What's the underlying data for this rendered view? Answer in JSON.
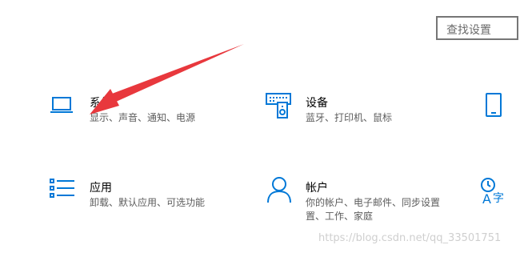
{
  "search": {
    "placeholder": "查找设置"
  },
  "tiles": [
    {
      "icon": "laptop-icon",
      "title": "系统",
      "description": "显示、声音、通知、电源"
    },
    {
      "icon": "devices-icon",
      "title": "设备",
      "description": "蓝牙、打印机、鼠标"
    },
    {
      "icon": "phone-icon",
      "title": "",
      "description": ""
    },
    {
      "icon": "apps-list-icon",
      "title": "应用",
      "description": "卸载、默认应用、可选功能"
    },
    {
      "icon": "person-icon",
      "title": "帐户",
      "description_lines": [
        "你的帐户、电子邮件、同步设置",
        "置、工作、家庭"
      ]
    },
    {
      "icon": "time-language-icon",
      "title": "",
      "description": ""
    }
  ],
  "watermark": "https://blog.csdn.net/qq_33501751",
  "colors": {
    "accent": "#0078d7",
    "annotation_arrow": "#e8383d"
  }
}
